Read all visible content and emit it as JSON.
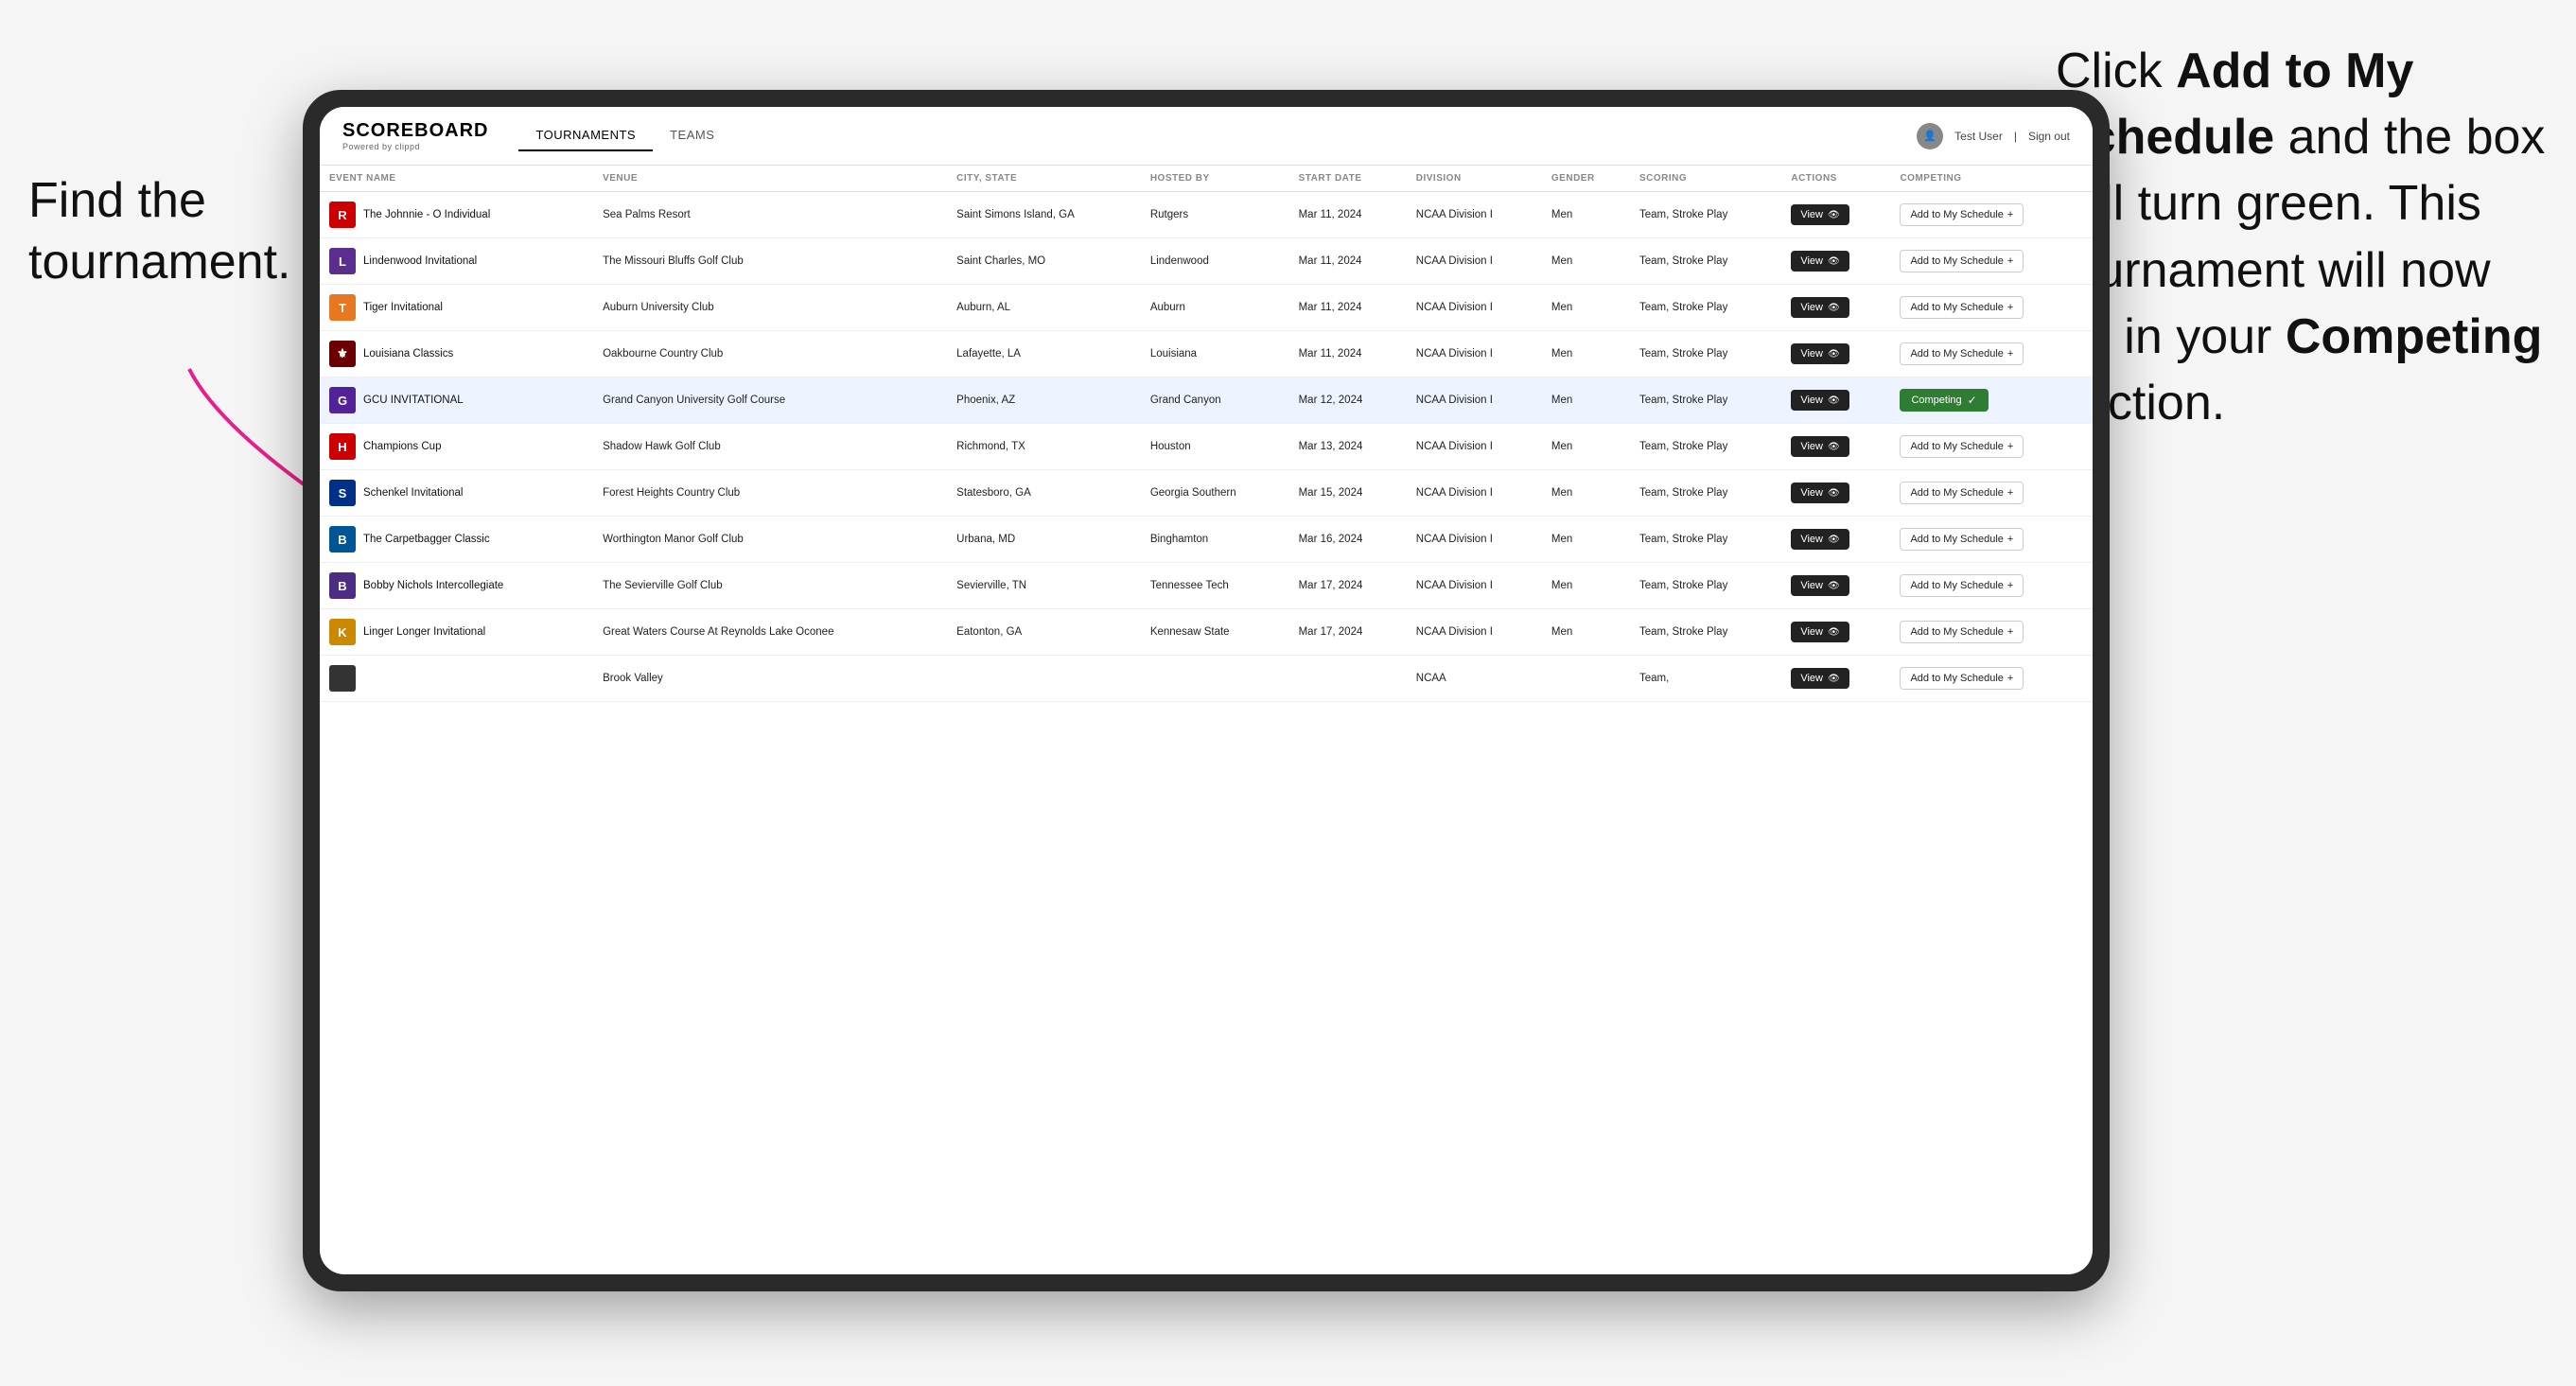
{
  "annotations": {
    "left": "Find the tournament.",
    "right_part1": "Click ",
    "right_bold1": "Add to My Schedule",
    "right_part2": " and the box will turn green. This tournament will now be in your ",
    "right_bold2": "Competing",
    "right_part3": " section."
  },
  "app": {
    "logo": "SCOREBOARD",
    "logo_sub": "Powered by clippd",
    "nav": [
      "TOURNAMENTS",
      "TEAMS"
    ],
    "active_nav": "TOURNAMENTS",
    "user": "Test User",
    "sign_out": "Sign out"
  },
  "table": {
    "columns": [
      "EVENT NAME",
      "VENUE",
      "CITY, STATE",
      "HOSTED BY",
      "START DATE",
      "DIVISION",
      "GENDER",
      "SCORING",
      "ACTIONS",
      "COMPETING"
    ],
    "rows": [
      {
        "logo": "🅁",
        "logo_color": "#cc0000",
        "event": "The Johnnie - O Individual",
        "venue": "Sea Palms Resort",
        "city_state": "Saint Simons Island, GA",
        "hosted_by": "Rutgers",
        "start_date": "Mar 11, 2024",
        "division": "NCAA Division I",
        "gender": "Men",
        "scoring": "Team, Stroke Play",
        "status": "add",
        "highlighted": false
      },
      {
        "logo": "🦁",
        "logo_color": "#5b2d8e",
        "event": "Lindenwood Invitational",
        "venue": "The Missouri Bluffs Golf Club",
        "city_state": "Saint Charles, MO",
        "hosted_by": "Lindenwood",
        "start_date": "Mar 11, 2024",
        "division": "NCAA Division I",
        "gender": "Men",
        "scoring": "Team, Stroke Play",
        "status": "add",
        "highlighted": false
      },
      {
        "logo": "🐯",
        "logo_color": "#e87722",
        "event": "Tiger Invitational",
        "venue": "Auburn University Club",
        "city_state": "Auburn, AL",
        "hosted_by": "Auburn",
        "start_date": "Mar 11, 2024",
        "division": "NCAA Division I",
        "gender": "Men",
        "scoring": "Team, Stroke Play",
        "status": "add",
        "highlighted": false
      },
      {
        "logo": "⚜",
        "logo_color": "#6b0000",
        "event": "Louisiana Classics",
        "venue": "Oakbourne Country Club",
        "city_state": "Lafayette, LA",
        "hosted_by": "Louisiana",
        "start_date": "Mar 11, 2024",
        "division": "NCAA Division I",
        "gender": "Men",
        "scoring": "Team, Stroke Play",
        "status": "add",
        "highlighted": false
      },
      {
        "logo": "🏔",
        "logo_color": "#522398",
        "event": "GCU INVITATIONAL",
        "venue": "Grand Canyon University Golf Course",
        "city_state": "Phoenix, AZ",
        "hosted_by": "Grand Canyon",
        "start_date": "Mar 12, 2024",
        "division": "NCAA Division I",
        "gender": "Men",
        "scoring": "Team, Stroke Play",
        "status": "competing",
        "highlighted": true
      },
      {
        "logo": "🅗",
        "logo_color": "#cc0000",
        "event": "Champions Cup",
        "venue": "Shadow Hawk Golf Club",
        "city_state": "Richmond, TX",
        "hosted_by": "Houston",
        "start_date": "Mar 13, 2024",
        "division": "NCAA Division I",
        "gender": "Men",
        "scoring": "Team, Stroke Play",
        "status": "add",
        "highlighted": false
      },
      {
        "logo": "🦅",
        "logo_color": "#003087",
        "event": "Schenkel Invitational",
        "venue": "Forest Heights Country Club",
        "city_state": "Statesboro, GA",
        "hosted_by": "Georgia Southern",
        "start_date": "Mar 15, 2024",
        "division": "NCAA Division I",
        "gender": "Men",
        "scoring": "Team, Stroke Play",
        "status": "add",
        "highlighted": false
      },
      {
        "logo": "🅑",
        "logo_color": "#005596",
        "event": "The Carpetbagger Classic",
        "venue": "Worthington Manor Golf Club",
        "city_state": "Urbana, MD",
        "hosted_by": "Binghamton",
        "start_date": "Mar 16, 2024",
        "division": "NCAA Division I",
        "gender": "Men",
        "scoring": "Team, Stroke Play",
        "status": "add",
        "highlighted": false
      },
      {
        "logo": "🎓",
        "logo_color": "#4b2e83",
        "event": "Bobby Nichols Intercollegiate",
        "venue": "The Sevierville Golf Club",
        "city_state": "Sevierville, TN",
        "hosted_by": "Tennessee Tech",
        "start_date": "Mar 17, 2024",
        "division": "NCAA Division I",
        "gender": "Men",
        "scoring": "Team, Stroke Play",
        "status": "add",
        "highlighted": false
      },
      {
        "logo": "🦌",
        "logo_color": "#cc8800",
        "event": "Linger Longer Invitational",
        "venue": "Great Waters Course At Reynolds Lake Oconee",
        "city_state": "Eatonton, GA",
        "hosted_by": "Kennesaw State",
        "start_date": "Mar 17, 2024",
        "division": "NCAA Division I",
        "gender": "Men",
        "scoring": "Team, Stroke Play",
        "status": "add",
        "highlighted": false
      },
      {
        "logo": "🏫",
        "logo_color": "#333",
        "event": "",
        "venue": "Brook Valley",
        "city_state": "",
        "hosted_by": "",
        "start_date": "",
        "division": "NCAA",
        "gender": "",
        "scoring": "Team,",
        "status": "add",
        "highlighted": false
      }
    ],
    "buttons": {
      "view": "View",
      "add_schedule": "Add to My Schedule",
      "competing": "Competing"
    }
  }
}
